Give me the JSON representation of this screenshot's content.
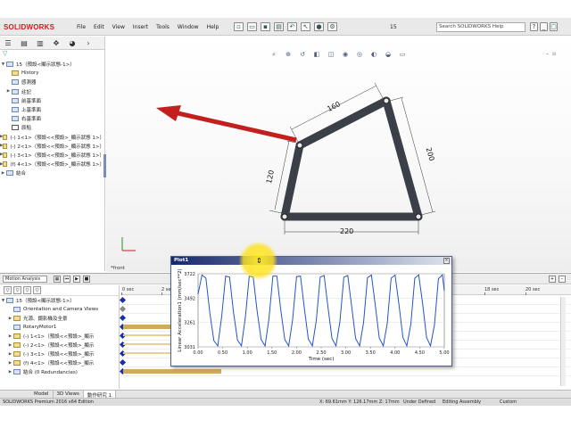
{
  "app": {
    "logo": "SOLIDWORKS"
  },
  "menu": [
    "File",
    "Edit",
    "View",
    "Insert",
    "Tools",
    "Window",
    "Help"
  ],
  "toolbar_icons": [
    "new-icon",
    "open-icon",
    "save-icon",
    "print-icon",
    "undo-icon",
    "select-icon",
    "rebuild-icon",
    "options-icon"
  ],
  "doc_number": "15",
  "help_search": {
    "placeholder": "Search SOLIDWORKS Help"
  },
  "feature_tree": {
    "root": "15（預設<顯示狀態-1>）",
    "items": [
      {
        "label": "History",
        "icon": "history-icon",
        "expand": false
      },
      {
        "label": "感測器",
        "icon": "sensor-icon",
        "expand": false
      },
      {
        "label": "註記",
        "icon": "annotation-icon",
        "expand": true
      },
      {
        "label": "前基準面",
        "icon": "plane-icon",
        "expand": false
      },
      {
        "label": "上基準面",
        "icon": "plane-icon",
        "expand": false
      },
      {
        "label": "右基準面",
        "icon": "plane-icon",
        "expand": false
      },
      {
        "label": "原點",
        "icon": "origin-icon",
        "expand": false
      },
      {
        "label": "(-) 1<1>（預設<<預設>_顯示狀態 1>）",
        "icon": "part-icon",
        "expand": true
      },
      {
        "label": "(-) 2<1>（預設<<預設>_顯示狀態 1>）",
        "icon": "part-icon",
        "expand": true
      },
      {
        "label": "(-) 3<1>（預設<<預設>_顯示狀態 1>）",
        "icon": "part-icon",
        "expand": true
      },
      {
        "label": "(f) 4<1>（預設<<預設>_顯示狀態 1>）",
        "icon": "part-icon",
        "expand": true
      },
      {
        "label": "結合",
        "icon": "mates-icon",
        "expand": true
      }
    ]
  },
  "graphics": {
    "view_label": "*front",
    "dimensions": [
      "160",
      "200",
      "120",
      "220"
    ]
  },
  "motion_study": {
    "type": "Motion Analysis",
    "ruler": [
      "0 sec",
      "2 sec",
      "18 sec",
      "20 sec"
    ],
    "tree": [
      {
        "label": "15（預設<顯示狀態-1>）",
        "expand": true
      },
      {
        "label": "Orientation and Camera Views",
        "expand": false
      },
      {
        "label": "光源、鏡影機及全景",
        "expand": true
      },
      {
        "label": "RotaryMotor1",
        "expand": false
      },
      {
        "label": "(-) 1<1>（預設<<預設>_顯示",
        "expand": true
      },
      {
        "label": "(-) 2<1>（預設<<預設>_顯示",
        "expand": true
      },
      {
        "label": "(-) 3<1>（預設<<預設>_顯示",
        "expand": true
      },
      {
        "label": "(f) 4<1>（預設<<預設>_顯示",
        "expand": true
      },
      {
        "label": "結合 (0 Redundancies)",
        "expand": true
      }
    ]
  },
  "plot": {
    "title": "Plot1"
  },
  "chart_data": {
    "type": "line",
    "xlabel": "Time (sec)",
    "ylabel": "Linear Acceleration1 (mm/sec**2)",
    "xlim": [
      0,
      5
    ],
    "ylim": [
      3031,
      3722
    ],
    "xticks": [
      "0.00",
      "0.50",
      "1.00",
      "1.50",
      "2.00",
      "2.50",
      "3.00",
      "3.50",
      "4.00",
      "4.50",
      "5.00"
    ],
    "yticks": [
      "3722",
      "3492",
      "3261",
      "3031"
    ],
    "series": [
      {
        "x": [
          0.0,
          0.08,
          0.16,
          0.24,
          0.32,
          0.4,
          0.48,
          0.56,
          0.64,
          0.72,
          0.8,
          0.88,
          0.96,
          1.04,
          1.12,
          1.2,
          1.28,
          1.36,
          1.44,
          1.52,
          1.6,
          1.68,
          1.76,
          1.84,
          1.92,
          2.0,
          2.08,
          2.16,
          2.24,
          2.32,
          2.4,
          2.48,
          2.56,
          2.64,
          2.72,
          2.8,
          2.88,
          2.96,
          3.04,
          3.12,
          3.2,
          3.28,
          3.36,
          3.44,
          3.52,
          3.6,
          3.68,
          3.76,
          3.84,
          3.92,
          4.0,
          4.08,
          4.16,
          4.24,
          4.32,
          4.4,
          4.48,
          4.56,
          4.64,
          4.72,
          4.8,
          4.88,
          4.96,
          5.0
        ],
        "y": [
          3530,
          3710,
          3680,
          3350,
          3090,
          3040,
          3320,
          3700,
          3690,
          3360,
          3095,
          3040,
          3310,
          3700,
          3690,
          3370,
          3100,
          3040,
          3300,
          3700,
          3700,
          3380,
          3100,
          3040,
          3290,
          3695,
          3700,
          3390,
          3105,
          3040,
          3280,
          3690,
          3705,
          3400,
          3110,
          3040,
          3270,
          3690,
          3705,
          3410,
          3110,
          3040,
          3260,
          3685,
          3710,
          3420,
          3115,
          3040,
          3250,
          3680,
          3710,
          3430,
          3120,
          3040,
          3245,
          3680,
          3712,
          3440,
          3120,
          3040,
          3240,
          3675,
          3712,
          3560
        ]
      }
    ]
  },
  "bottom_tabs": [
    "Model",
    "3D Views",
    "動作研究 1"
  ],
  "status": {
    "version": "SOLIDWORKS Premium 2016 x64 Edition",
    "coords": "X: 69.61mm  Y: 126.17mm  Z: 17mm",
    "defined": "Under Defined",
    "editing": "Editing Assembly",
    "custom": "Custom"
  }
}
